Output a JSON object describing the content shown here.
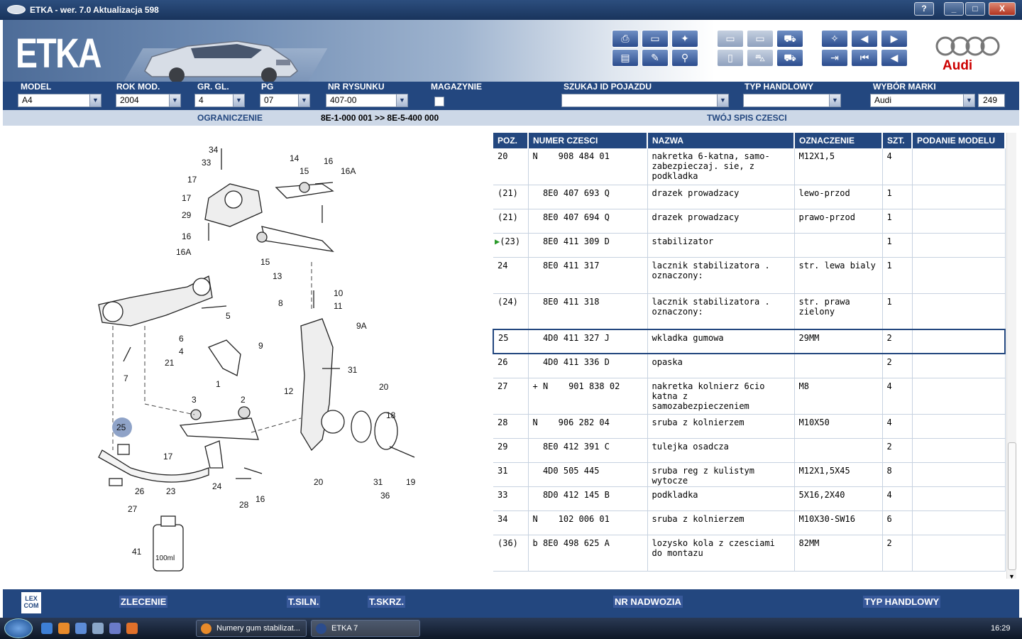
{
  "window": {
    "title": "ETKA - wer. 7.0 Aktualizacja 598",
    "btn_help": "?",
    "btn_min": "_",
    "btn_max": "□",
    "btn_close": "X"
  },
  "header": {
    "logo": "ETKA",
    "brand": "Audi"
  },
  "fields": {
    "model": {
      "label": "MODEL",
      "value": "A4"
    },
    "rok": {
      "label": "ROK MOD.",
      "value": "2004"
    },
    "grgl": {
      "label": "GR. GL.",
      "value": "4"
    },
    "pg": {
      "label": "PG",
      "value": "07"
    },
    "nr": {
      "label": "NR RYSUNKU",
      "value": "407-00"
    },
    "magazynie": {
      "label": "MAGAZYNIE"
    },
    "szukaj": {
      "label": "SZUKAJ ID POJAZDU",
      "value": ""
    },
    "typ": {
      "label": "TYP HANDLOWY",
      "value": ""
    },
    "marka": {
      "label": "WYBÓR MARKI",
      "value": "Audi"
    },
    "count": "249"
  },
  "info": {
    "ograniczenie": "OGRANICZENIE",
    "range": "8E-1-000 001 >> 8E-5-400 000",
    "spis": "TWÓJ SPIS CZESCI"
  },
  "table": {
    "headers": [
      "POZ.",
      "NUMER CZESCI",
      "NAZWA",
      "OZNACZENIE",
      "SZT.",
      "PODANIE MODELU"
    ],
    "rows": [
      {
        "poz": "20",
        "num": "N    908 484 01",
        "nazwa": "nakretka 6-katna, samo- zabezpieczaj. sie, z podkladka",
        "ozn": "M12X1,5",
        "szt": "4"
      },
      {
        "poz": "(21)",
        "num": "  8E0 407 693 Q",
        "nazwa": "drazek prowadzacy",
        "ozn": "lewo-przod",
        "szt": "1"
      },
      {
        "poz": "(21)",
        "num": "  8E0 407 694 Q",
        "nazwa": "drazek prowadzacy",
        "ozn": "prawo-przod",
        "szt": "1"
      },
      {
        "poz": "(23)",
        "num": "  8E0 411 309 D",
        "nazwa": "stabilizator",
        "ozn": "",
        "szt": "1",
        "marker": "▶"
      },
      {
        "poz": "24",
        "num": "  8E0 411 317",
        "nazwa": "lacznik stabilizatora . oznaczony:",
        "ozn": "str. lewa bialy",
        "szt": "1"
      },
      {
        "poz": "(24)",
        "num": "  8E0 411 318",
        "nazwa": "lacznik stabilizatora . oznaczony:",
        "ozn": "str. prawa zielony",
        "szt": "1"
      },
      {
        "poz": "25",
        "num": "  4D0 411 327 J",
        "nazwa": "wkladka gumowa",
        "ozn": "29MM",
        "szt": "2",
        "selected": true
      },
      {
        "poz": "26",
        "num": "  4D0 411 336 D",
        "nazwa": "opaska",
        "ozn": "",
        "szt": "2"
      },
      {
        "poz": "27",
        "num": "+ N    901 838 02",
        "nazwa": "nakretka kolnierz 6cio katna z samozabezpieczeniem",
        "ozn": "M8",
        "szt": "4"
      },
      {
        "poz": "28",
        "num": "N    906 282 04",
        "nazwa": "sruba z kolnierzem",
        "ozn": "M10X50",
        "szt": "4"
      },
      {
        "poz": "29",
        "num": "  8E0 412 391 C",
        "nazwa": "tulejka osadcza",
        "ozn": "",
        "szt": "2"
      },
      {
        "poz": "31",
        "num": "  4D0 505 445",
        "nazwa": "sruba reg z kulistym wytocze",
        "ozn": "M12X1,5X45",
        "szt": "8"
      },
      {
        "poz": "33",
        "num": "  8D0 412 145 B",
        "nazwa": "podkladka",
        "ozn": "5X16,2X40",
        "szt": "4"
      },
      {
        "poz": "34",
        "num": "N    102 006 01",
        "nazwa": "sruba z kolnierzem",
        "ozn": "M10X30-SW16",
        "szt": "6"
      },
      {
        "poz": "(36)",
        "num": "b 8E0 498 625 A",
        "nazwa": "lozysko kola z czesciami do montazu",
        "ozn": "82MM",
        "szt": "2"
      }
    ]
  },
  "diagram": {
    "labels": [
      "34",
      "33",
      "17",
      "17",
      "29",
      "16",
      "16A",
      "14",
      "15",
      "16",
      "16A",
      "15",
      "13",
      "5",
      "6",
      "8",
      "10",
      "11",
      "9A",
      "9",
      "4",
      "21",
      "1",
      "7",
      "31",
      "12",
      "20",
      "3",
      "2",
      "18",
      "25",
      "17",
      "24",
      "23",
      "26",
      "27",
      "28",
      "16",
      "20",
      "31",
      "19",
      "36",
      "41",
      "100ml"
    ],
    "highlight": "25"
  },
  "bottom": {
    "lex": "LEX COM",
    "links": [
      "ZLECENIE",
      "T.SILN.",
      "T.SKRZ.",
      "NR NADWOZIA",
      "TYP HANDLOWY"
    ]
  },
  "taskbar": {
    "tasks": [
      "Numery gum stabilizat...",
      "ETKA 7"
    ],
    "clock": "16:29"
  }
}
